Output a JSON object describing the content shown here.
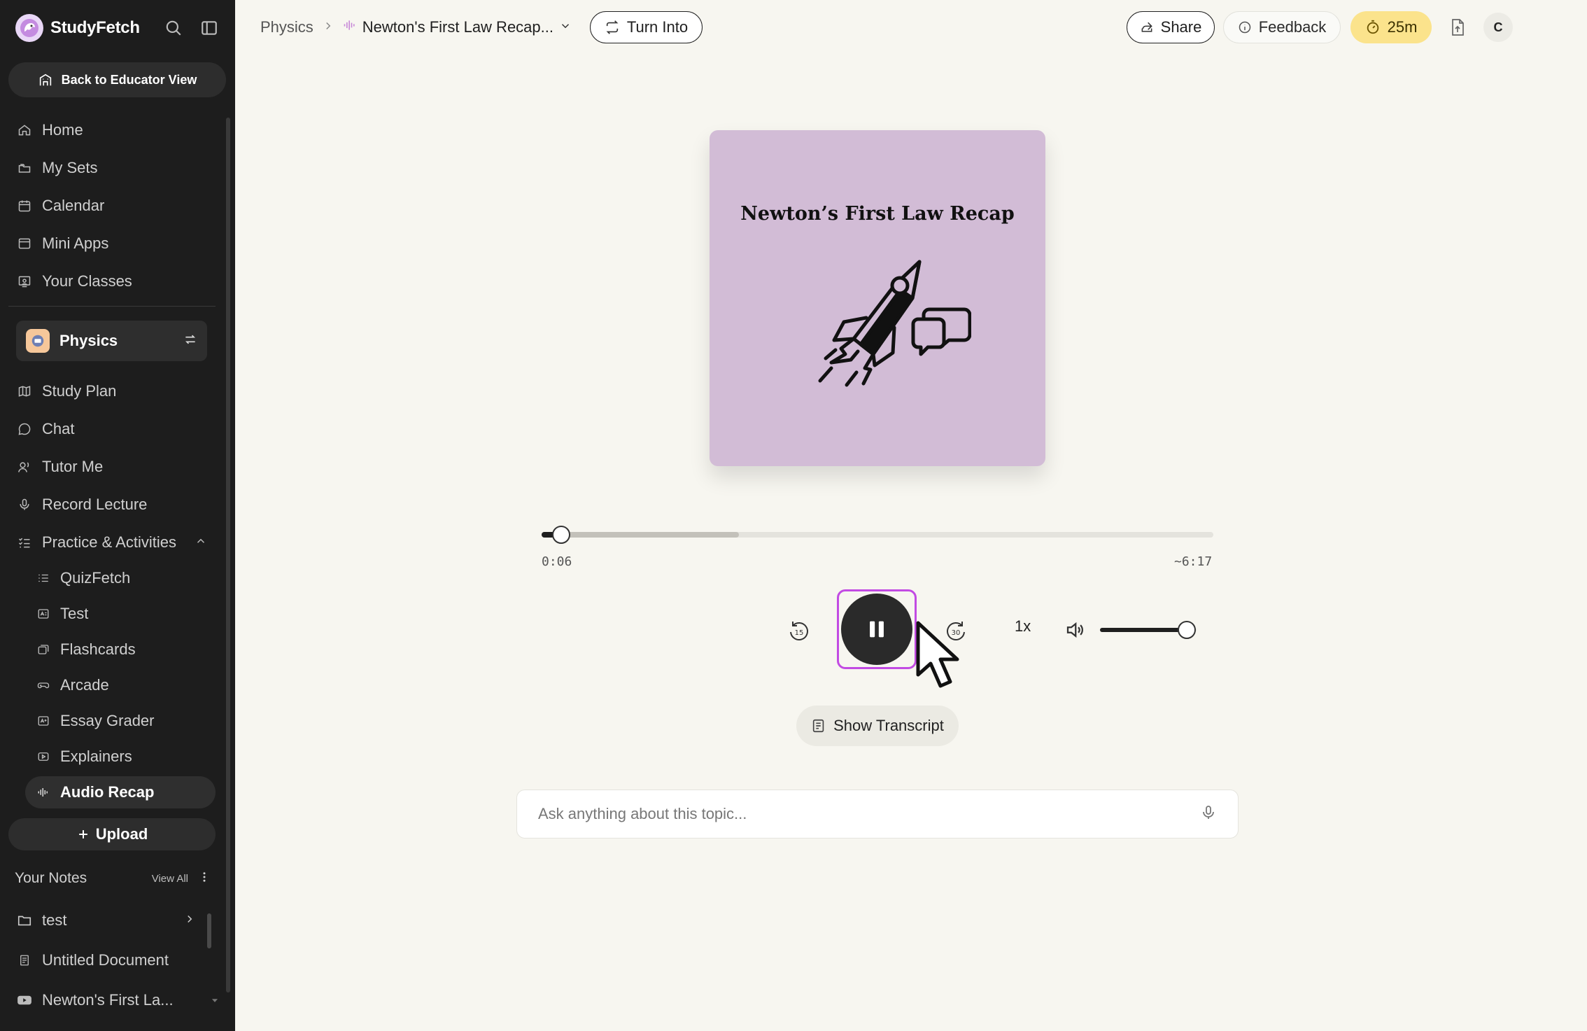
{
  "app": {
    "name": "StudyFetch"
  },
  "sidebar": {
    "educator_button": "Back to Educator View",
    "main_nav": [
      {
        "label": "Home",
        "icon": "home-icon"
      },
      {
        "label": "My Sets",
        "icon": "folders-icon"
      },
      {
        "label": "Calendar",
        "icon": "calendar-icon"
      },
      {
        "label": "Mini Apps",
        "icon": "window-icon"
      },
      {
        "label": "Your Classes",
        "icon": "classroom-icon"
      }
    ],
    "current_class": "Physics",
    "class_nav": [
      {
        "label": "Study Plan",
        "icon": "map-icon"
      },
      {
        "label": "Chat",
        "icon": "chat-bubble-icon"
      },
      {
        "label": "Tutor Me",
        "icon": "tutor-icon"
      },
      {
        "label": "Record Lecture",
        "icon": "microphone-icon"
      },
      {
        "label": "Practice & Activities",
        "icon": "checklist-icon"
      }
    ],
    "activities": [
      {
        "label": "QuizFetch",
        "icon": "list-icon"
      },
      {
        "label": "Test",
        "icon": "test-icon"
      },
      {
        "label": "Flashcards",
        "icon": "cards-icon"
      },
      {
        "label": "Arcade",
        "icon": "gamepad-icon"
      },
      {
        "label": "Essay Grader",
        "icon": "essay-icon"
      },
      {
        "label": "Explainers",
        "icon": "play-box-icon"
      },
      {
        "label": "Audio Recap",
        "icon": "audio-wave-icon"
      }
    ],
    "upload_label": "Upload",
    "notes": {
      "title": "Your Notes",
      "view_all": "View All",
      "items": [
        {
          "label": "test",
          "icon": "folder-icon"
        },
        {
          "label": "Untitled Document",
          "icon": "document-icon"
        },
        {
          "label": "Newton's First La...",
          "icon": "youtube-icon"
        }
      ]
    }
  },
  "header": {
    "breadcrumb_root": "Physics",
    "breadcrumb_current": "Newton's First Law Recap...",
    "turn_into": "Turn Into",
    "share": "Share",
    "feedback": "Feedback",
    "timer": "25m",
    "avatar_initial": "C"
  },
  "player": {
    "cover_title": "Newton’s First Law Recap",
    "cover_color": "#d2bcd6",
    "current_time": "0:06",
    "total_time": "~6:17",
    "progress": 0.029,
    "buffered": 0.294,
    "rewind_seconds": "15",
    "forward_seconds": "30",
    "speed": "1x",
    "volume": 0.9,
    "state": "playing",
    "transcript_button": "Show Transcript",
    "accent_color": "#c24be3"
  },
  "ask": {
    "placeholder": "Ask anything about this topic..."
  }
}
